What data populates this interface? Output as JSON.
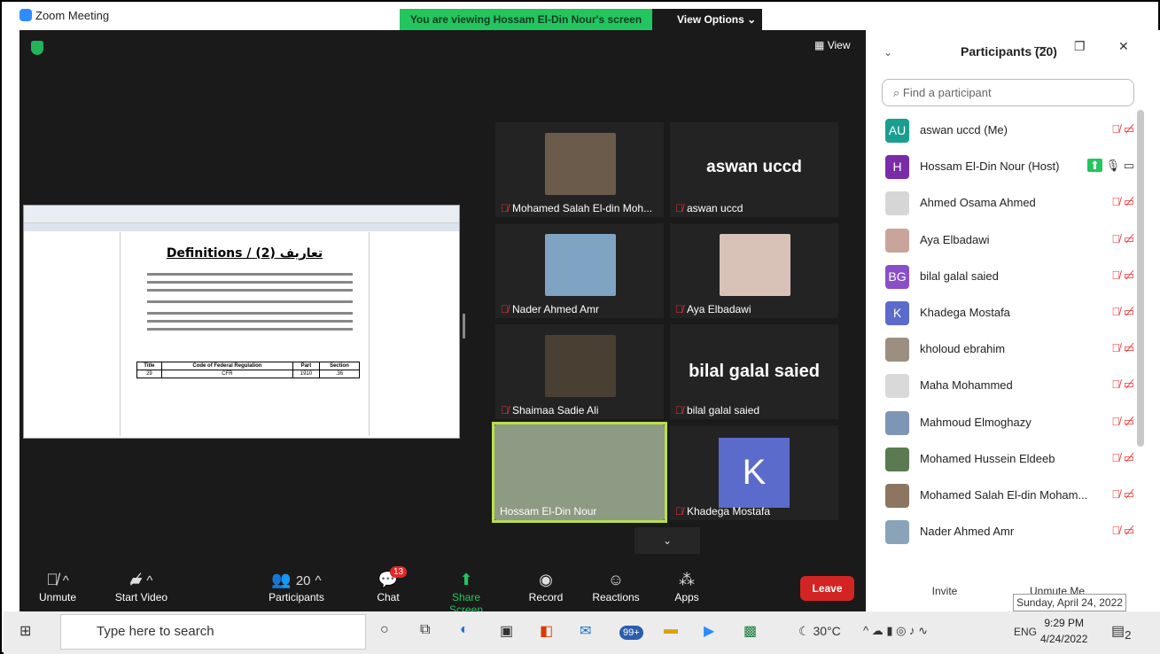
{
  "window": {
    "title": "Zoom Meeting",
    "banner": "You are viewing Hossam El-Din Nour's screen",
    "view_options": "View Options",
    "view_button": "View"
  },
  "shared_doc": {
    "heading": "Definitions / تعاريف (2)",
    "table_headers": [
      "Title",
      "Code of Federal Regulation",
      "Part",
      "Section"
    ],
    "table_row": [
      "29",
      "CFR",
      "1910",
      ".36"
    ]
  },
  "tiles": [
    {
      "name": "Mohamed Salah El-din Moh...",
      "muted": true
    },
    {
      "name": "aswan uccd",
      "big": "aswan uccd",
      "muted": true
    },
    {
      "name": "Nader Ahmed Amr",
      "muted": true
    },
    {
      "name": "Aya Elbadawi",
      "muted": true
    },
    {
      "name": "Shaimaa Sadie Ali",
      "muted": true
    },
    {
      "name": "bilal galal saied",
      "big": "bilal galal saied",
      "muted": true
    },
    {
      "name": "Hossam El-Din Nour",
      "muted": false
    },
    {
      "name": "Khadega Mostafa",
      "initial": "K",
      "muted": true
    }
  ],
  "toolbar": {
    "unmute": "Unmute",
    "start_video": "Start Video",
    "participants_count": "20",
    "participants": "Participants",
    "chat_badge": "13",
    "chat": "Chat",
    "share": "Share Screen",
    "record": "Record",
    "reactions": "Reactions",
    "apps": "Apps",
    "leave": "Leave"
  },
  "panel": {
    "title": "Participants (20)",
    "search_placeholder": "Find a participant",
    "invite": "Invite",
    "unmute_me": "Unmute Me",
    "participants": [
      {
        "name": "aswan uccd (Me)",
        "initials": "AU",
        "color": "#1a9e8f"
      },
      {
        "name": "Hossam El-Din Nour (Host)",
        "initials": "H",
        "color": "#7a2ca8"
      },
      {
        "name": "Ahmed Osama Ahmed",
        "initials": "",
        "color": "#d6d6d6"
      },
      {
        "name": "Aya Elbadawi",
        "initials": "",
        "color": "#c9a49b"
      },
      {
        "name": "bilal galal saied",
        "initials": "BG",
        "color": "#8a4fc7"
      },
      {
        "name": "Khadega Mostafa",
        "initials": "K",
        "color": "#5b6bcc"
      },
      {
        "name": "kholoud ebrahim",
        "initials": "",
        "color": "#9c8f82"
      },
      {
        "name": "Maha Mohammed",
        "initials": "",
        "color": "#d9d9d9"
      },
      {
        "name": "Mahmoud Elmoghazy",
        "initials": "",
        "color": "#7f95b5"
      },
      {
        "name": "Mohamed Hussein Eldeeb",
        "initials": "",
        "color": "#5a7a52"
      },
      {
        "name": "Mohamed Salah El-din Moham...",
        "initials": "",
        "color": "#8c7660"
      },
      {
        "name": "Nader Ahmed Amr",
        "initials": "",
        "color": "#8aa3b8"
      }
    ]
  },
  "tooltip": "Sunday, April 24, 2022",
  "taskbar": {
    "search": "Type here to search",
    "badge": "99+",
    "temp": "30°C",
    "lang": "ENG",
    "time": "9:29 PM",
    "date": "4/24/2022",
    "notif": "2"
  }
}
